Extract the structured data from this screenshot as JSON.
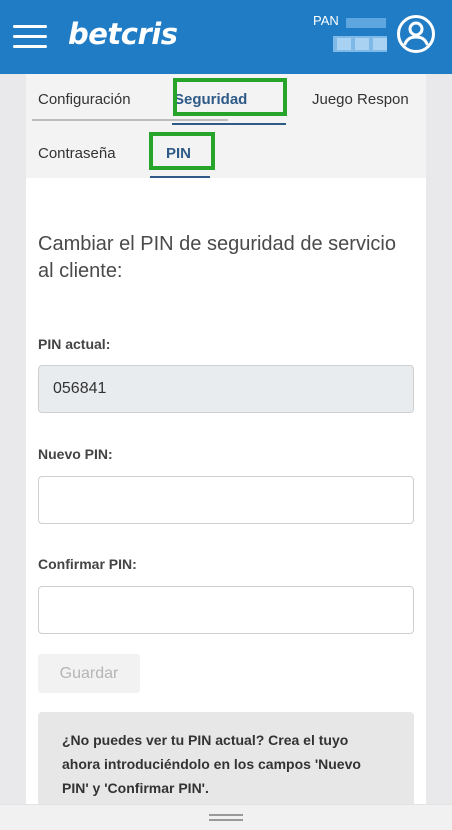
{
  "header": {
    "logo": "betcris",
    "account_label": "PAN",
    "menu_icon": "hamburger-menu-icon",
    "user_icon": "user-circle-icon",
    "brand_color": "#1f7cc5"
  },
  "tabs": {
    "primary": [
      {
        "label": "Configuración"
      },
      {
        "label": "Seguridad",
        "active": true
      },
      {
        "label": "Juego Respon"
      }
    ],
    "secondary": [
      {
        "label": "Contraseña"
      },
      {
        "label": "PIN",
        "active": true
      }
    ]
  },
  "form": {
    "title": "Cambiar el PIN de seguridad de servicio al cliente:",
    "current_label": "PIN actual:",
    "current_value": "056841",
    "new_label": "Nuevo PIN:",
    "new_value": "",
    "confirm_label": "Confirmar PIN:",
    "confirm_value": "",
    "save_label": "Guardar",
    "info_text": "¿No puedes ver tu PIN actual? Crea el tuyo ahora introduciéndolo en los campos 'Nuevo PIN' y 'Confirmar PIN'."
  },
  "colors": {
    "highlight": "#27a52b",
    "active_tab": "#2e5a88"
  }
}
